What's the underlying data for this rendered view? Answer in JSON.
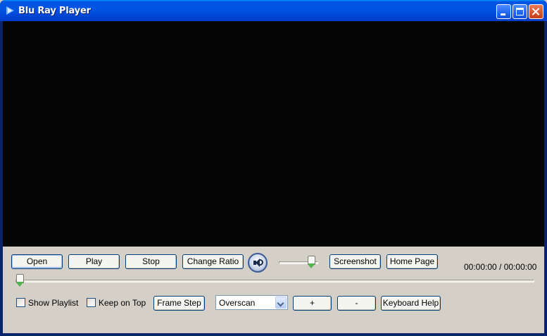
{
  "window": {
    "title": "Blu Ray Player",
    "icon": "play-arrow-icon",
    "controls": [
      "minimize-icon",
      "maximize-icon",
      "close-icon"
    ],
    "title_color": "#0055e5"
  },
  "toolbar": {
    "open_label": "Open",
    "play_label": "Play",
    "stop_label": "Stop",
    "change_ratio_label": "Change Ratio",
    "screenshot_label": "Screenshot",
    "home_page_label": "Home Page",
    "volume_icon": "speaker-icon",
    "volume_level": 0.9
  },
  "time": {
    "current": "00:00:00",
    "separator": "/",
    "total": "00:00:00"
  },
  "seek": {
    "position": 0.0
  },
  "options": {
    "show_playlist_label": "Show Playlist",
    "show_playlist_checked": false,
    "keep_on_top_label": "Keep on Top",
    "keep_on_top_checked": false,
    "frame_step_label": "Frame Step",
    "scan_mode_selected": "Overscan",
    "plus_label": "+",
    "minus_label": "-",
    "keyboard_help_label": "Keyboard Help"
  }
}
